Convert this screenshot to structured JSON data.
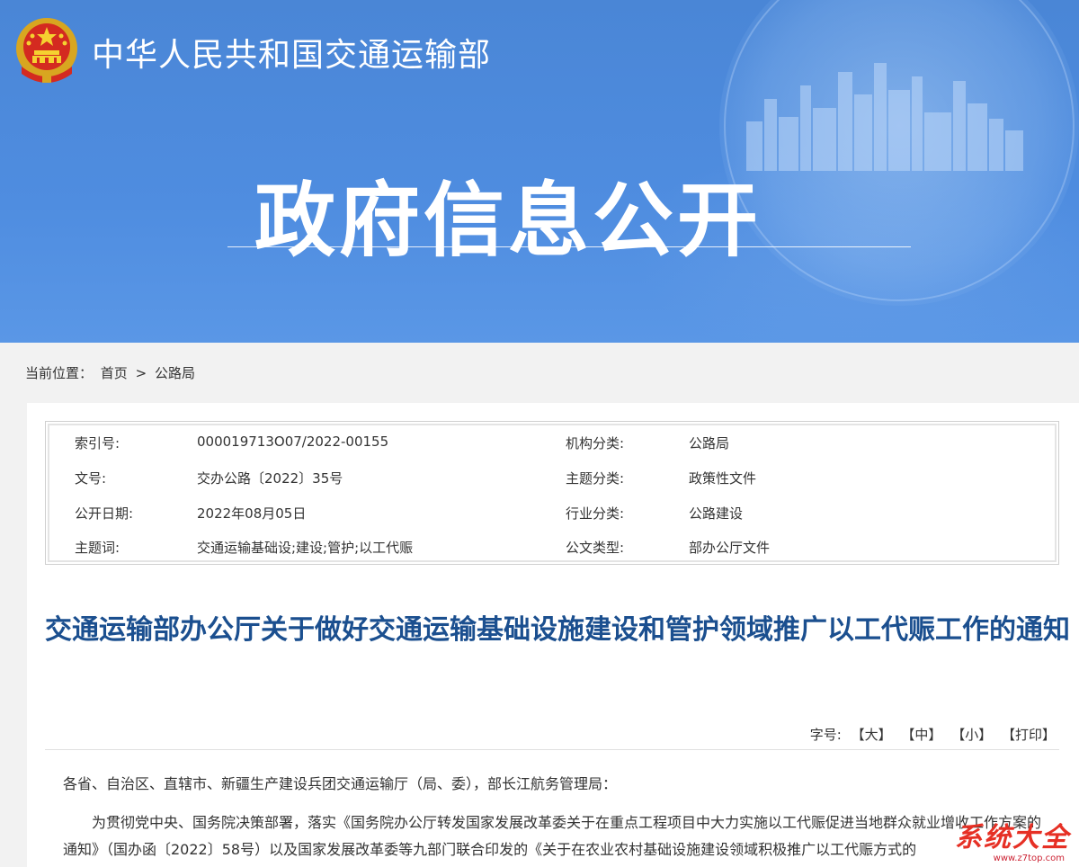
{
  "header": {
    "site_name": "中华人民共和国交通运输部",
    "banner_title": "政府信息公开"
  },
  "breadcrumb": {
    "label": "当前位置：",
    "home": "首页",
    "separator": ">",
    "current": "公路局"
  },
  "meta": {
    "rows": [
      {
        "label1": "索引号:",
        "value1": "000019713O07/2022-00155",
        "label2": "机构分类:",
        "value2": "公路局"
      },
      {
        "label1": "文号:",
        "value1": "交办公路〔2022〕35号",
        "label2": "主题分类:",
        "value2": "政策性文件"
      },
      {
        "label1": "公开日期:",
        "value1": "2022年08月05日",
        "label2": "行业分类:",
        "value2": "公路建设"
      },
      {
        "label1": "主题词:",
        "value1": "交通运输基础设;建设;管护;以工代赈",
        "label2": "公文类型:",
        "value2": "部办公厅文件"
      }
    ]
  },
  "document": {
    "title": "交通运输部办公厅关于做好交通运输基础设施建设和管护领域推广以工代赈工作的通知",
    "font_tools": {
      "label": "字号:",
      "large": "【大】",
      "medium": "【中】",
      "small": "【小】",
      "print": "【打印】"
    },
    "paragraphs": [
      "各省、自治区、直辖市、新疆生产建设兵团交通运输厅（局、委），部长江航务管理局：",
      "为贯彻党中央、国务院决策部署，落实《国务院办公厅转发国家发展改革委关于在重点工程项目中大力实施以工代赈促进当地群众就业增收工作方案的通知》（国办函〔2022〕58号）以及国家发展改革委等九部门联合印发的《关于在农业农村基础设施建设领域积极推广以工代赈方式的"
    ]
  },
  "watermark": {
    "text": "系统大全",
    "url": "www.z7top.com"
  },
  "colors": {
    "banner": "#4f8de0",
    "title": "#1b4f8f",
    "watermark": "#e63025"
  }
}
